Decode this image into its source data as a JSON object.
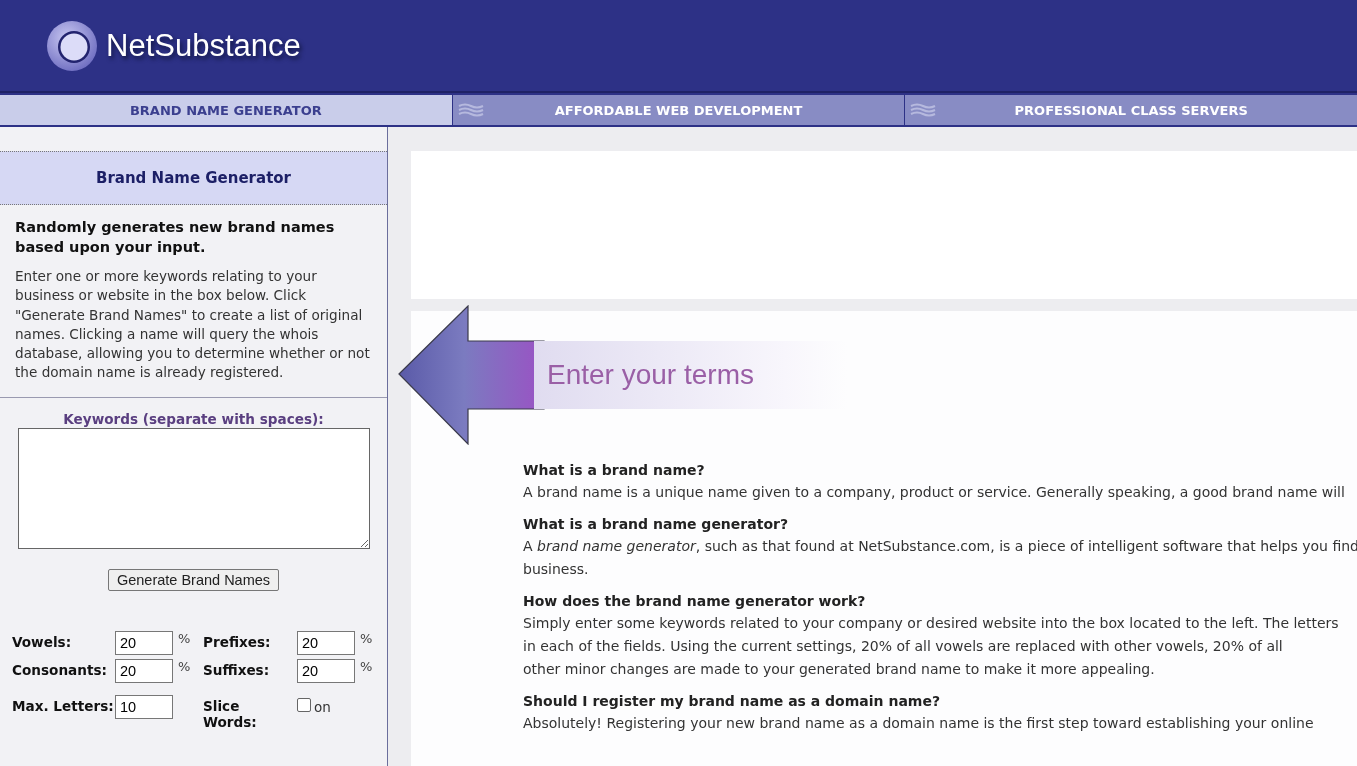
{
  "header": {
    "logo": "NetSubstance"
  },
  "tabs": [
    {
      "label": "BRAND NAME GENERATOR",
      "selected": true
    },
    {
      "label": "AFFORDABLE WEB DEVELOPMENT",
      "selected": false
    },
    {
      "label": "PROFESSIONAL CLASS SERVERS",
      "selected": false
    }
  ],
  "sidebar": {
    "title": "Brand Name Generator",
    "lead": "Randomly generates new brand names based upon your input.",
    "description": "Enter one or more keywords relating to your business or website in the box below. Click \"Generate Brand Names\" to create a list of original names. Clicking a name will query the whois database, allowing you to determine whether or not the domain name is already registered.",
    "keywords_label": "Keywords (separate with spaces):",
    "button": "Generate Brand Names",
    "settings": [
      {
        "kind": "number",
        "label": "Vowels:",
        "value": "20",
        "unit": "%"
      },
      {
        "kind": "number",
        "label": "Prefixes:",
        "value": "20",
        "unit": "%"
      },
      {
        "kind": "number",
        "label": "Consonants:",
        "value": "20",
        "unit": "%"
      },
      {
        "kind": "number",
        "label": "Suffixes:",
        "value": "20",
        "unit": "%"
      },
      {
        "kind": "number",
        "label": "Max. Letters:",
        "value": "10"
      },
      {
        "kind": "checkbox",
        "label": "Slice Words:",
        "checked": false,
        "option": "on"
      }
    ]
  },
  "content": {
    "banner": "Enter your terms",
    "faq": [
      {
        "question": "What is a brand name?",
        "lines": [
          "A brand name is a unique name given to a company, product or service. Generally speaking, a good brand name will"
        ]
      },
      {
        "question": "What is a brand name generator?",
        "lines": [
          "A *brand name generator*, such as that found at NetSubstance.com, is a piece of intelligent software that helps you find",
          "business."
        ]
      },
      {
        "question": "How does the brand name generator work?",
        "lines": [
          "Simply enter some keywords related to your company or desired website into the box located to the left. The letters",
          "in each of the fields. Using the current settings, 20% of all vowels are replaced with other vowels, 20% of all",
          "other minor changes are made to your generated brand name to make it more appealing."
        ]
      },
      {
        "question": "Should I register my brand name as a domain name?",
        "lines": [
          "Absolutely! Registering your new brand name as a domain name is the first step toward establishing your online"
        ]
      }
    ]
  }
}
